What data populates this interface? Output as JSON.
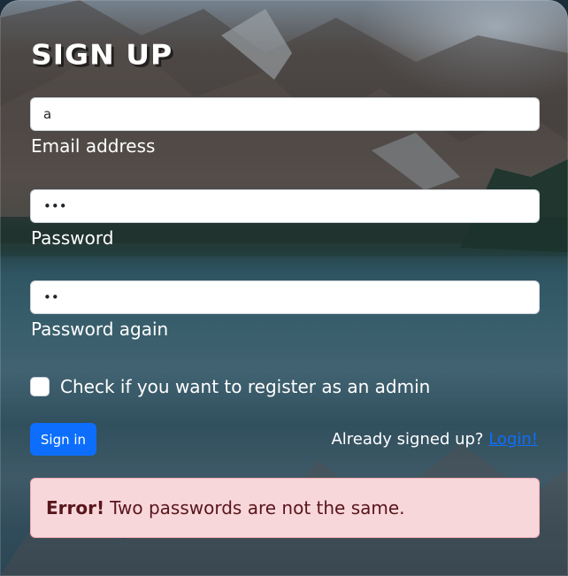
{
  "form": {
    "title": "SIGN UP",
    "email": {
      "value": "a",
      "label": "Email address"
    },
    "password": {
      "value": "•••",
      "label": "Password"
    },
    "password_again": {
      "value": "••",
      "label": "Password again"
    },
    "admin_checkbox": {
      "label": "Check if you want to register as an admin",
      "checked": false
    },
    "submit_label": "Sign in",
    "already_text": "Already signed up?",
    "login_link": "Login!"
  },
  "alert": {
    "strong": "Error!",
    "message": "Two passwords are not the same."
  },
  "colors": {
    "primary": "#0d6efd",
    "alert_bg": "#f8d7da",
    "alert_text": "#58151c"
  }
}
